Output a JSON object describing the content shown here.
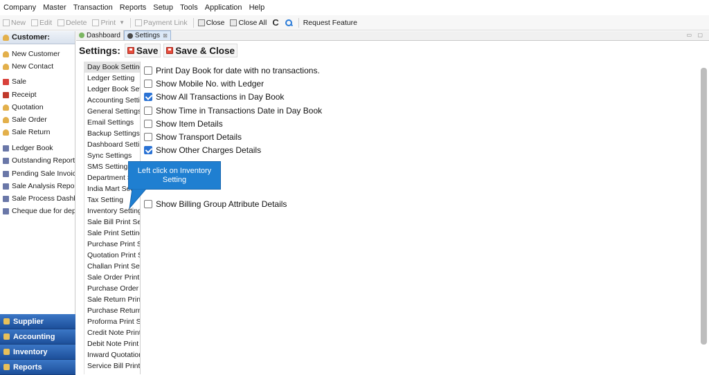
{
  "menu": [
    "Company",
    "Master",
    "Transaction",
    "Reports",
    "Setup",
    "Tools",
    "Application",
    "Help"
  ],
  "toolbar": {
    "new": "New",
    "edit": "Edit",
    "delete": "Delete",
    "print": "Print",
    "print_arrow": "▼",
    "payment_link": "Payment Link",
    "close": "Close",
    "close_all": "Close All",
    "refresh": "C",
    "request_feature": "Request Feature"
  },
  "sidebar": {
    "header": "Customer:",
    "items": [
      {
        "label": "New Customer",
        "icon": "user-icon"
      },
      {
        "label": "New Contact",
        "icon": "user-icon"
      },
      {
        "label": "Sale",
        "icon": "sale-icon"
      },
      {
        "label": "Receipt",
        "icon": "receipt-icon"
      },
      {
        "label": "Quotation",
        "icon": "user-icon"
      },
      {
        "label": "Sale Order",
        "icon": "user-icon"
      },
      {
        "label": "Sale Return",
        "icon": "user-icon"
      },
      {
        "label": "Ledger Book",
        "icon": "report-icon"
      },
      {
        "label": "Outstanding Report",
        "icon": "report-icon"
      },
      {
        "label": "Pending Sale Invoices",
        "icon": "report-icon"
      },
      {
        "label": "Sale Analysis Report",
        "icon": "report-icon"
      },
      {
        "label": "Sale Process Dashboard",
        "icon": "report-icon"
      },
      {
        "label": "Cheque due for deposit",
        "icon": "report-icon"
      }
    ],
    "modules": [
      "Supplier",
      "Accounting",
      "Inventory",
      "Reports"
    ]
  },
  "tabs": [
    {
      "label": "Dashboard",
      "active": false
    },
    {
      "label": "Settings",
      "active": true
    }
  ],
  "settings": {
    "title": "Settings:",
    "save": "Save",
    "save_close": "Save & Close",
    "list": [
      "Day Book Setting",
      "Ledger Setting",
      "Ledger Book Setting",
      "Accounting Setting",
      "General Settings",
      "Email Settings",
      "Backup Settings",
      "Dashboard Settings",
      "Sync Settings",
      "SMS Settings",
      "Department Setting",
      "India Mart Setting",
      "Tax Setting",
      "Inventory Setting",
      "Sale Bill Print Setting",
      "Sale Print Setting",
      "Purchase Print Setting",
      "Quotation Print Setting",
      "Challan Print Setting",
      "Sale Order Print Setting",
      "Purchase Order Print Setting",
      "Sale Return Print Setting",
      "Purchase Return Print Setting",
      "Proforma Print Setting",
      "Credit Note Print Setting",
      "Debit Note Print Setting",
      "Inward Quotation",
      "Service Bill Print Setting"
    ],
    "selected_index": 0,
    "options": [
      {
        "label": "Print Day Book for date with no transactions.",
        "checked": false
      },
      {
        "label": "Show Mobile No. with Ledger",
        "checked": false
      },
      {
        "label": "Show All Transactions in Day Book",
        "checked": true
      },
      {
        "label": "Show Time in Transactions Date in Day Book",
        "checked": false
      },
      {
        "label": "Show Item Details",
        "checked": false
      },
      {
        "label": "Show Transport Details",
        "checked": false
      },
      {
        "label": "Show Other Charges Details",
        "checked": true
      },
      {
        "label": "Show Billing Group Attribute Details",
        "checked": false
      }
    ]
  },
  "tooltip": "Left click  on Inventory Setting",
  "colors": {
    "accent": "#2a72d4",
    "tooltip": "#1f7fd1",
    "module": "#1d4f9a"
  }
}
